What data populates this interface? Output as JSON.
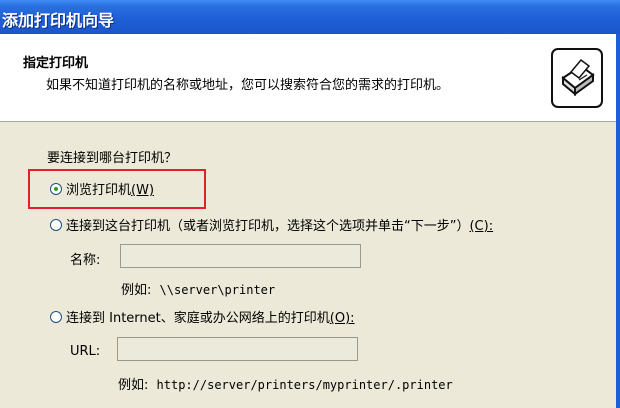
{
  "window": {
    "title": "添加打印机向导"
  },
  "header": {
    "title": "指定打印机",
    "subtitle": "如果不知道打印机的名称或地址，您可以搜索符合您的需求的打印机。",
    "icon": "printer-icon"
  },
  "question": "要连接到哪台打印机？",
  "options": {
    "browse": {
      "label": "浏览打印机",
      "mnemonic": "(W)",
      "selected": true
    },
    "connect_this": {
      "label": "连接到这台打印机（或者浏览打印机，选择这个选项并单击“下一步”）",
      "mnemonic": "(C):",
      "selected": false
    },
    "connect_internet": {
      "label": "连接到 Internet、家庭或办公网络上的打印机",
      "mnemonic": "(O):",
      "selected": false
    }
  },
  "name_field": {
    "label": "名称:",
    "value": "",
    "example_prefix": "例如:",
    "example_value": "\\\\server\\printer"
  },
  "url_field": {
    "label": "URL:",
    "value": "",
    "example_prefix": "例如:",
    "example_value": "http://server/printers/myprinter/.printer"
  },
  "colors": {
    "titlebar": "#1f5fd6",
    "highlight_box": "#e0202a",
    "radio_dot": "#21a121"
  }
}
